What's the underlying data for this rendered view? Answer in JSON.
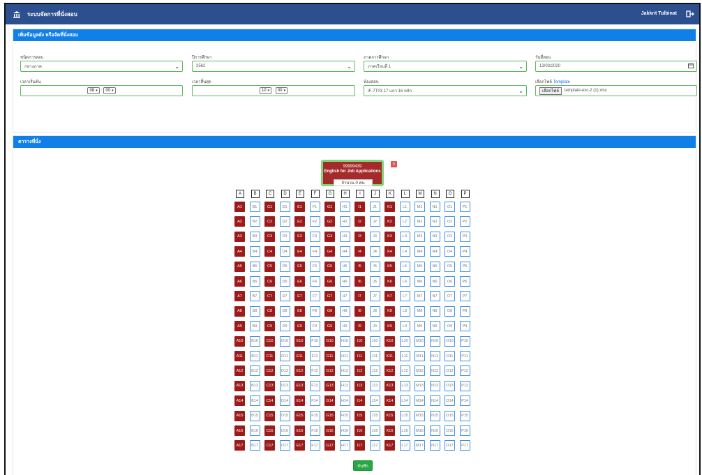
{
  "header": {
    "title": "ระบบจัดการที่นั่งสอบ",
    "user": "Jakkrit Tulbinat",
    "logo_icon": "university-logo-icon",
    "logout_icon": "logout-icon"
  },
  "form": {
    "panel_title": "เพิ่มข้อมูลผัง หรือจัดที่นั่งสอบ",
    "exam_type": {
      "label": "ชนิดการสอบ",
      "value": "กลางภาค"
    },
    "academic_year": {
      "label": "ปีการศึกษา",
      "value": "2562"
    },
    "semester": {
      "label": "ภาคการศึกษา",
      "value": "ภาคเรียนที่ 1"
    },
    "exam_date": {
      "label": "วันที่สอบ",
      "value": "13/03/2020"
    },
    "start_time": {
      "label": "เวลาเริ่มต้น",
      "hour": "08",
      "minute": "00"
    },
    "end_time": {
      "label": "เวลาสิ้นสุด",
      "hour": "10",
      "minute": "00"
    },
    "room": {
      "label": "ห้องสอบ",
      "value": "IF-7T03     17 แถว 16 หลัก"
    },
    "file": {
      "label": "เลือกไฟล์",
      "template_link": "Template",
      "button": "เลือกไฟล์",
      "filename": "template-exc-2 (1).xlsx"
    }
  },
  "seating": {
    "panel_title": "ตารางที่นั่ง",
    "columns": [
      "A",
      "B",
      "C",
      "D",
      "E",
      "F",
      "G",
      "H",
      "I",
      "J",
      "K",
      "L",
      "M",
      "N",
      "O",
      "P"
    ],
    "taken_columns": [
      "A",
      "C",
      "E",
      "G",
      "I",
      "K"
    ],
    "rows": 17,
    "popup": {
      "code": "99999439",
      "subject": "English for Job Applications",
      "count": "จำนวน 0 คน",
      "close": "×"
    },
    "save_label": "บันทึก"
  },
  "colors": {
    "topbar": "#2b4f8f",
    "panel_header": "#1080e8",
    "seat_taken": "#9b1b1b",
    "seat_free_border": "#3a8ee6",
    "save_button": "#28a745"
  }
}
